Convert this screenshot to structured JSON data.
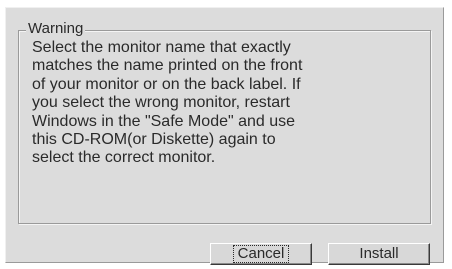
{
  "dialog": {
    "group_title": "Warning",
    "message": "Select the monitor name that exactly\nmatches the name printed on the front\nof your monitor or on the back label. If\nyou select the wrong monitor, restart\nWindows in the \"Safe Mode\" and use\nthis CD-ROM(or Diskette) again to\nselect the correct monitor.",
    "buttons": {
      "cancel_label": "Cancel",
      "install_label": "Install"
    }
  }
}
